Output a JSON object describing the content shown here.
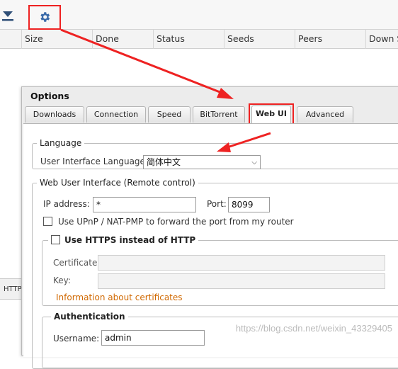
{
  "toolbar": {
    "download_icon": "download-arrow-icon",
    "settings_icon": "gear-icon"
  },
  "columns": [
    "Size",
    "Done",
    "Status",
    "Seeds",
    "Peers",
    "Down S"
  ],
  "left_tab_label": "HTTP",
  "dialog": {
    "title": "Options",
    "tabs": [
      "Downloads",
      "Connection",
      "Speed",
      "BitTorrent",
      "Web UI",
      "Advanced"
    ],
    "active_tab": "Web UI",
    "language": {
      "legend": "Language",
      "label": "User Interface Language:",
      "value": "简体中文"
    },
    "webui": {
      "legend": "Web User Interface (Remote control)",
      "ip_label": "IP address:",
      "ip_value": "*",
      "port_label": "Port:",
      "port_value": "8099",
      "upnp_label": "Use UPnP / NAT-PMP to forward the port from my router",
      "https": {
        "legend": "Use HTTPS instead of HTTP",
        "certificate_label": "Certificate:",
        "key_label": "Key:",
        "info_link": "Information about certificates"
      },
      "auth": {
        "legend": "Authentication",
        "username_label": "Username:",
        "username_value": "admin"
      }
    }
  },
  "watermark": "https://blog.csdn.net/weixin_43329405",
  "colors": {
    "annotation_red": "#ee2222",
    "link_orange": "#d06800",
    "icon_blue": "#3a6aa8"
  }
}
